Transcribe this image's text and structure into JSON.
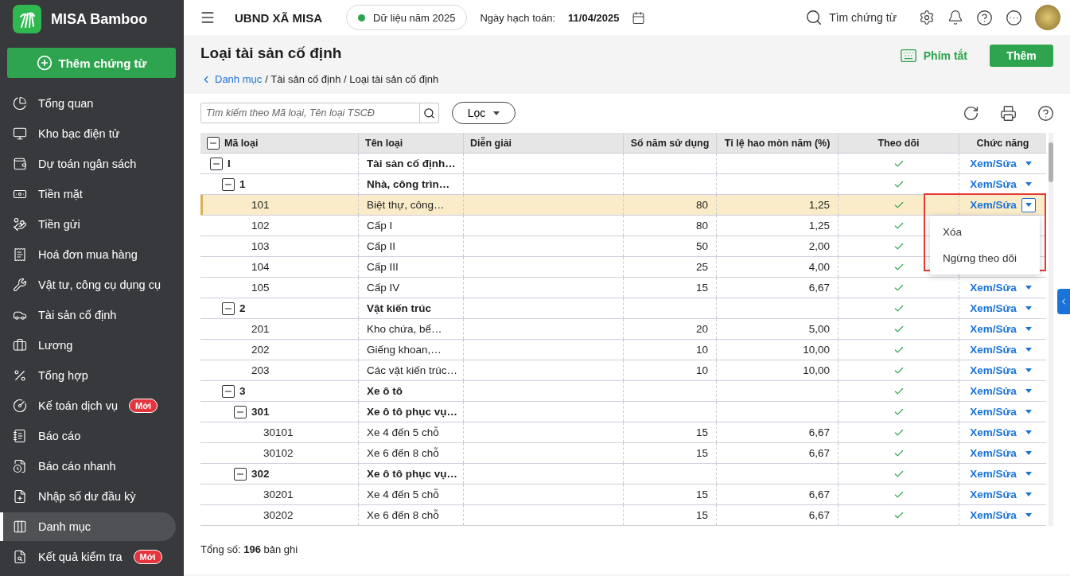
{
  "app": {
    "name": "MISA Bamboo"
  },
  "sidebar": {
    "primary_button": "Thêm chứng từ",
    "items": [
      {
        "label": "Tổng quan",
        "selected": false
      },
      {
        "label": "Kho bạc điện tử",
        "selected": false
      },
      {
        "label": "Dự toán ngân sách",
        "selected": false
      },
      {
        "label": "Tiền mặt",
        "selected": false
      },
      {
        "label": "Tiền gửi",
        "selected": false
      },
      {
        "label": "Hoá đơn mua hàng",
        "selected": false
      },
      {
        "label": "Vật tư, công cụ dụng cụ",
        "selected": false
      },
      {
        "label": "Tài sản cố định",
        "selected": false
      },
      {
        "label": "Lương",
        "selected": false
      },
      {
        "label": "Tổng hợp",
        "selected": false
      },
      {
        "label": "Kế toán dịch vụ",
        "selected": false,
        "badge": "Mới"
      },
      {
        "label": "Báo cáo",
        "selected": false
      },
      {
        "label": "Báo cáo nhanh",
        "selected": false
      },
      {
        "label": "Nhập số dư đầu kỳ",
        "selected": false
      },
      {
        "label": "Danh mục",
        "selected": true
      },
      {
        "label": "Kết quả kiểm tra",
        "selected": false,
        "badge": "Mới"
      }
    ]
  },
  "topbar": {
    "organization": "UBND XÃ MISA",
    "data_year": "Dữ liệu năm 2025",
    "posting_date_label": "Ngày hạch toán:",
    "posting_date": "11/04/2025",
    "search_label": "Tìm chứng từ"
  },
  "page": {
    "title": "Loại tài sản cố định",
    "breadcrumb": [
      {
        "label": "Danh mục",
        "kind": "link"
      },
      {
        "label": "/ Tài sản cố định / Loại tài sản cố định",
        "kind": "text"
      }
    ],
    "shortcut_button": "Phím tắt",
    "add_button": "Thêm"
  },
  "toolbar": {
    "search": {
      "placeholder": "Tìm kiếm theo Mã loại, Tên loại TSCĐ"
    },
    "filter_button": "Lọc"
  },
  "table": {
    "columns": [
      "Mã loại",
      "Tên loại",
      "Diễn giải",
      "Số năm sử dụng",
      "Tỉ lệ hao mòn năm (%)",
      "Theo dõi",
      "Chức năng"
    ],
    "rows": [
      {
        "kind": "group",
        "code": "I",
        "name": "Tài sản cố định…",
        "expanded": true,
        "tracked": true,
        "selected": false,
        "action": "Xem/Sửa",
        "menu_open": false,
        "children": [
          {
            "kind": "group",
            "code": "1",
            "name": "Nhà, công trìn…",
            "expanded": true,
            "tracked": true,
            "selected": false,
            "action": "Xem/Sửa",
            "menu_open": false,
            "children": [
              {
                "kind": "item",
                "code": "101",
                "name": "Biệt thự, công…",
                "years": "80",
                "rate": "1,25",
                "tracked": true,
                "selected": true,
                "action": "Xem/Sửa",
                "menu_open": true
              },
              {
                "kind": "item",
                "code": "102",
                "name": "Cấp I",
                "years": "80",
                "rate": "1,25",
                "tracked": true,
                "selected": false,
                "menu_open": false
              },
              {
                "kind": "item",
                "code": "103",
                "name": "Cấp II",
                "years": "50",
                "rate": "2,00",
                "tracked": true,
                "selected": false,
                "menu_open": false
              },
              {
                "kind": "item",
                "code": "104",
                "name": "Cấp III",
                "years": "25",
                "rate": "4,00",
                "tracked": true,
                "selected": false,
                "menu_open": false
              },
              {
                "kind": "item",
                "code": "105",
                "name": "Cấp IV",
                "years": "15",
                "rate": "6,67",
                "tracked": true,
                "selected": false,
                "action": "Xem/Sửa",
                "menu_open": false
              }
            ]
          },
          {
            "kind": "group",
            "code": "2",
            "name": "Vật kiến trúc",
            "expanded": true,
            "tracked": true,
            "selected": false,
            "action": "Xem/Sửa",
            "menu_open": false,
            "children": [
              {
                "kind": "item",
                "code": "201",
                "name": "Kho chứa, bể…",
                "years": "20",
                "rate": "5,00",
                "tracked": true,
                "selected": false,
                "action": "Xem/Sửa",
                "menu_open": false
              },
              {
                "kind": "item",
                "code": "202",
                "name": "Giếng khoan,…",
                "years": "10",
                "rate": "10,00",
                "tracked": true,
                "selected": false,
                "action": "Xem/Sửa",
                "menu_open": false
              },
              {
                "kind": "item",
                "code": "203",
                "name": "Các vật kiến trúc…",
                "years": "10",
                "rate": "10,00",
                "tracked": true,
                "selected": false,
                "action": "Xem/Sửa",
                "menu_open": false
              }
            ]
          },
          {
            "kind": "group",
            "code": "3",
            "name": "Xe ô tô",
            "expanded": true,
            "tracked": true,
            "selected": false,
            "action": "Xem/Sửa",
            "menu_open": false,
            "children": [
              {
                "kind": "group",
                "code": "301",
                "name": "Xe ô tô phục vụ…",
                "expanded": true,
                "tracked": true,
                "selected": false,
                "action": "Xem/Sửa",
                "menu_open": false,
                "children": [
                  {
                    "kind": "item",
                    "code": "30101",
                    "name": "Xe 4 đến 5 chỗ",
                    "years": "15",
                    "rate": "6,67",
                    "tracked": true,
                    "selected": false,
                    "action": "Xem/Sửa",
                    "menu_open": false
                  },
                  {
                    "kind": "item",
                    "code": "30102",
                    "name": "Xe 6 đến 8 chỗ",
                    "years": "15",
                    "rate": "6,67",
                    "tracked": true,
                    "selected": false,
                    "action": "Xem/Sửa",
                    "menu_open": false
                  }
                ]
              },
              {
                "kind": "group",
                "code": "302",
                "name": "Xe ô tô phục vụ…",
                "expanded": true,
                "tracked": true,
                "selected": false,
                "action": "Xem/Sửa",
                "menu_open": false,
                "children": [
                  {
                    "kind": "item",
                    "code": "30201",
                    "name": "Xe 4 đến 5 chỗ",
                    "years": "15",
                    "rate": "6,67",
                    "tracked": true,
                    "selected": false,
                    "action": "Xem/Sửa",
                    "menu_open": false
                  },
                  {
                    "kind": "item",
                    "code": "30202",
                    "name": "Xe 6 đến 8 chỗ",
                    "years": "15",
                    "rate": "6,67",
                    "tracked": true,
                    "selected": false,
                    "action": "Xem/Sửa",
                    "menu_open": false
                  }
                ]
              }
            ]
          }
        ]
      }
    ]
  },
  "row_menu": {
    "items": [
      "Xóa",
      "Ngừng theo dõi"
    ]
  },
  "footer": {
    "total": "Tổng số:  **196** bản ghi"
  }
}
